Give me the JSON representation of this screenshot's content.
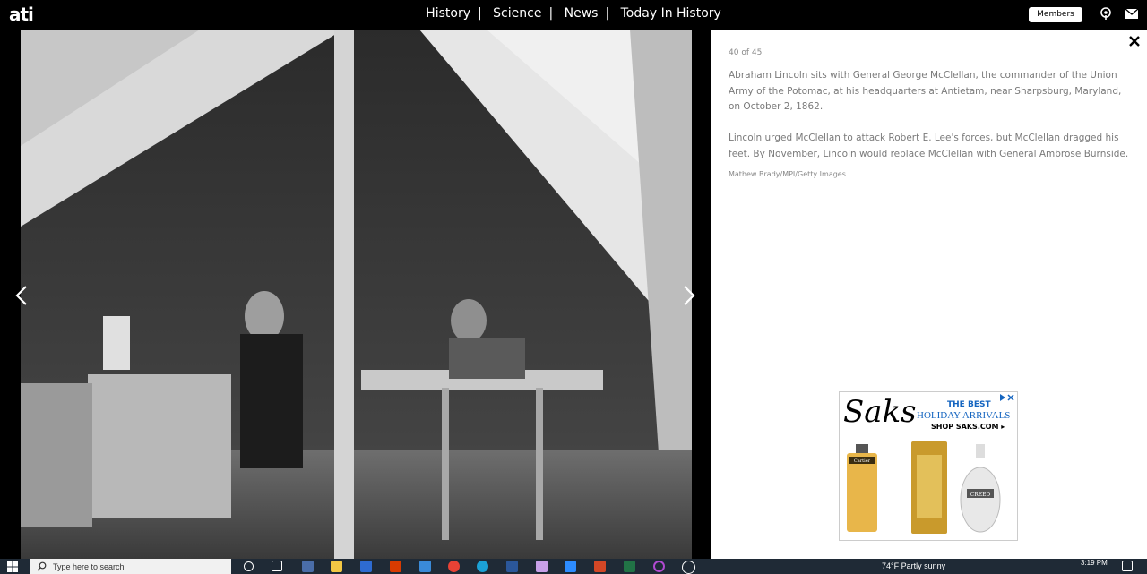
{
  "header": {
    "logo": "ati",
    "nav": [
      "History",
      "Science",
      "News",
      "Today In History"
    ],
    "members_label": "Members"
  },
  "gallery": {
    "counter": "40 of 45",
    "caption_p1": "Abraham Lincoln sits with General George McClellan, the commander of the Union Army of the Potomac, at his headquarters at Antietam, near Sharpsburg, Maryland, on October 2, 1862.",
    "caption_p2": "Lincoln urged McClellan to attack Robert E. Lee's forces, but McClellan dragged his feet. By November, Lincoln would replace McClellan with General Ambrose Burnside.",
    "credit": "Mathew Brady/MPI/Getty Images"
  },
  "ad": {
    "brand": "Saks",
    "headline": "THE BEST",
    "subheadline": "HOLIDAY ARRIVALS",
    "cta": "SHOP SAKS.COM ▸",
    "products": [
      "Cartier",
      "",
      "CREED"
    ]
  },
  "taskbar": {
    "search_placeholder": "Type here to search",
    "weather": "74°F  Partly sunny",
    "time": "3:19 PM"
  },
  "colors": {
    "accent_blue": "#1565c0",
    "taskbar_bg": "#1f2a36"
  }
}
